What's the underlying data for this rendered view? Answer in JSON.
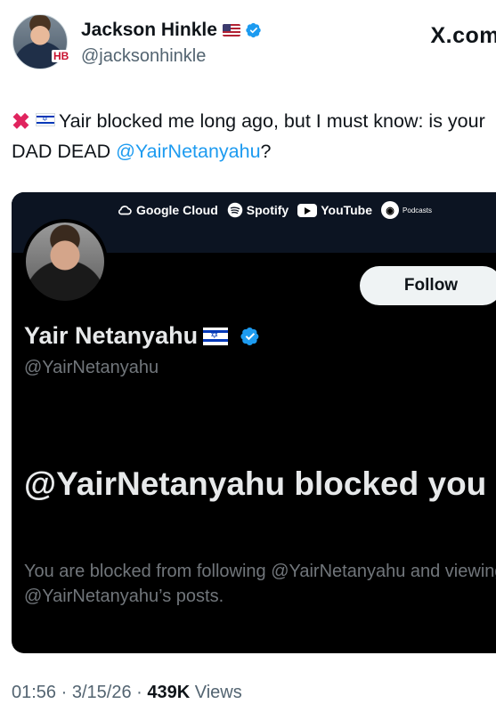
{
  "author": {
    "display_name": "Jackson Hinkle",
    "handle": "@jacksonhinkle",
    "avatar_badge": "HB",
    "flag_icon": "us-flag-icon",
    "verified_icon": "verified-badge-icon"
  },
  "platform": {
    "logo": "X.com"
  },
  "tweet": {
    "prefix_icons": [
      "red-x-icon",
      "israel-flag-icon"
    ],
    "text_part1": "Yair blocked me long ago, but I must know: is your DAD DEAD ",
    "mention": "@YairNetanyahu",
    "text_part2": "?"
  },
  "embedded_screenshot": {
    "banner_brands": [
      "Google Cloud",
      "Spotify",
      "YouTube",
      "Podcasts"
    ],
    "follow_label": "Follow",
    "profile_name": "Yair Netanyahu",
    "profile_handle": "@YairNetanyahu",
    "blocked_title": "@YairNetanyahu blocked you",
    "blocked_description": "You are blocked from following @YairNetanyahu and viewing @YairNetanyahu’s posts."
  },
  "meta": {
    "time": "01:56",
    "date": "3/15/26",
    "views_count": "439K",
    "views_label": "Views"
  },
  "colors": {
    "link": "#1d9bf0",
    "verified": "#1d9bf0",
    "card_background": "#000000",
    "red_x": "#e0245e"
  }
}
